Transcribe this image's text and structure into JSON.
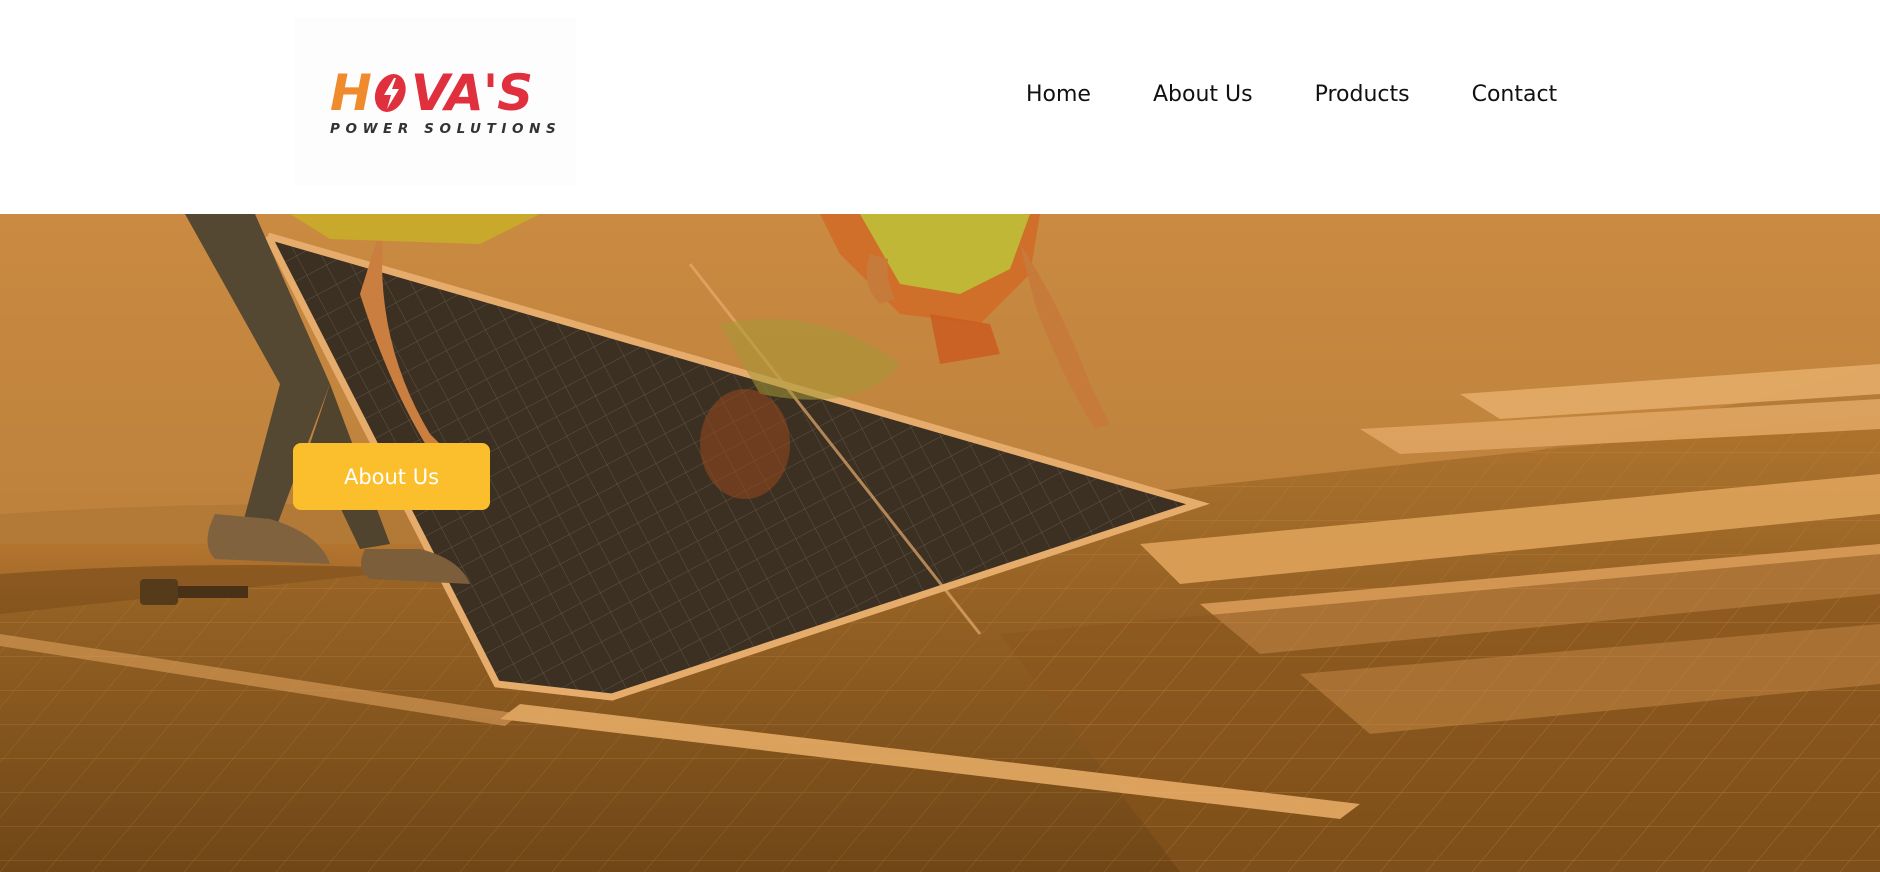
{
  "brand": {
    "logo_letter_h": "H",
    "logo_rest": "VA'S",
    "logo_tagline": "POWER SOLUTIONS",
    "colors": {
      "orange": "#f08b2d",
      "red": "#e0303d",
      "tagline": "#333333"
    },
    "icon": "lightning-bolt-icon"
  },
  "nav": {
    "items": [
      {
        "label": "Home"
      },
      {
        "label": "About Us"
      },
      {
        "label": "Products"
      },
      {
        "label": "Contact"
      }
    ]
  },
  "hero": {
    "button_label": "About Us",
    "button_color": "#fbbf2e",
    "overlay_tint": "#c98a44"
  }
}
